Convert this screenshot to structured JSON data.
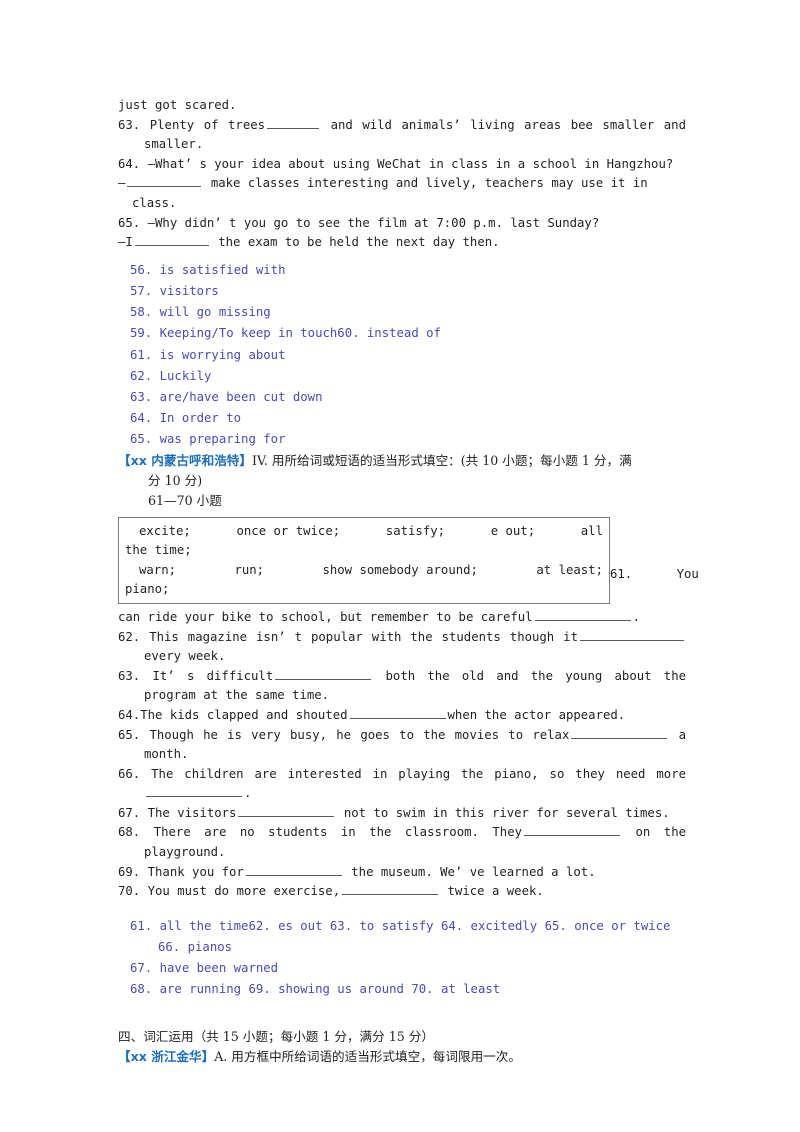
{
  "document": {
    "type": "english-exam-worksheet-page",
    "colors": {
      "body_text": "#231f20",
      "answer_key_blue": "#4a4ab4",
      "source_tag_blue": "#1f6fb8",
      "blank_rule": "#5a5a5a",
      "box_border": "#7d7d7d",
      "background": "#ffffff"
    }
  },
  "section_top": {
    "continuation_line": "just got scared.",
    "questions": [
      {
        "number": "63.",
        "text_before": "Plenty of trees",
        "text_after": "and wild animals’  living areas bee smaller and smaller."
      },
      {
        "number": "64.",
        "prompt": "—What’ s your idea about using WeChat in class in a school in Hangzhou?",
        "reply_before": "—",
        "reply_after": "make classes interesting and lively, teachers may use it in class."
      },
      {
        "number": "65.",
        "prompt": "—Why didn’ t you go to see the film at 7:00 p.m. last Sunday?",
        "reply_before": "—I",
        "reply_after": "the exam to be held the next day then."
      }
    ]
  },
  "answer_key_top": {
    "lines": [
      "56. is satisfied with",
      "57. visitors",
      "58. will go missing",
      "59. Keeping/To keep in touch60. instead of",
      "61. is worrying about",
      "62. Luckily",
      "63. are/have been cut down",
      "64. In order to",
      "65. was preparing for"
    ]
  },
  "section_inner_mongolia": {
    "source_tag": "【xx 内蒙古呼和浩特】",
    "instruction": "IV. 用所给词或短语的适当形式填空：(共 10 小题；每小题 1 分，满",
    "instruction_line2": "分 10 分)",
    "question_range": "61—70 小题",
    "word_bank": {
      "row1_left": "excite;",
      "row1_mid1": "once or twice;",
      "row1_mid2": "satisfy;",
      "row1_mid3": "e out;",
      "row1_right": "all",
      "row2": "the time;",
      "row3_left": "warn;",
      "row3_mid1": "run;",
      "row3_mid2": "show somebody around;",
      "row3_right": "at least;",
      "row4": "piano;"
    },
    "questions": [
      {
        "number": "61.",
        "lead": "61.      You",
        "text_before": "can ride your bike to school, but remember to be careful",
        "text_after": "."
      },
      {
        "number": "62.",
        "text_before": "This magazine isn’ t popular with the students though it",
        "text_after": "every week."
      },
      {
        "number": "63.",
        "text_before": "It’ s difficult",
        "text_after": "both the old and the young about the program at the same time."
      },
      {
        "number": "64.",
        "text_before": "The kids clapped and shouted",
        "text_after": "when the actor appeared."
      },
      {
        "number": "65.",
        "text_before": "Though he is very busy, he goes to the movies to relax",
        "text_after": "a month."
      },
      {
        "number": "66.",
        "text_before": "The children are interested in playing the piano, so they need more",
        "text_after": "."
      },
      {
        "number": "67.",
        "text_before": "The visitors",
        "text_after": "not to swim in this river for several times."
      },
      {
        "number": "68.",
        "text_before": "There are no students in the classroom. They",
        "text_after": "on the playground."
      },
      {
        "number": "69.",
        "text_before": "Thank you for",
        "text_after": "the museum. We’ ve learned a lot."
      },
      {
        "number": "70.",
        "text_before": "You must do more exercise,",
        "text_after": "twice a week."
      }
    ]
  },
  "answer_key_bottom": {
    "line1": "61. all the time62. es out 63. to satisfy  64. excitedly 65. once  or  twice",
    "line2": "66. pianos",
    "line3": "67. have been warned",
    "line4": "68. are running 69. showing us around   70. at least"
  },
  "section_jinhua": {
    "heading": "四、词汇运用（共 15 小题；每小题 1 分，满分 15 分）",
    "source_tag": "【xx 浙江金华】",
    "instruction": "A. 用方框中所给词语的适当形式填空，每词限用一次。"
  }
}
